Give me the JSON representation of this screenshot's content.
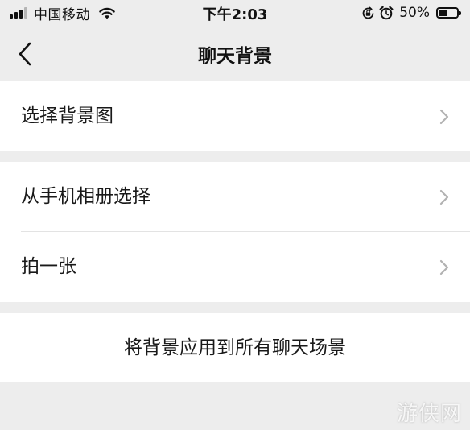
{
  "status_bar": {
    "carrier": "中国移动",
    "time": "下午2:03",
    "battery_percent": "50%",
    "battery_level": 0.5
  },
  "nav": {
    "back_icon": "chevron-left-icon",
    "title": "聊天背景"
  },
  "groups": [
    {
      "items": [
        {
          "label": "选择背景图",
          "icon": "chevron-right-icon"
        }
      ]
    },
    {
      "items": [
        {
          "label": "从手机相册选择",
          "icon": "chevron-right-icon"
        },
        {
          "label": "拍一张",
          "icon": "chevron-right-icon"
        }
      ]
    },
    {
      "items": [
        {
          "label": "将背景应用到所有聊天场景"
        }
      ]
    }
  ],
  "watermark": "游侠网",
  "colors": {
    "page_background": "#ededed",
    "cell_background": "#ffffff",
    "chevron": "#b2b2b2"
  }
}
